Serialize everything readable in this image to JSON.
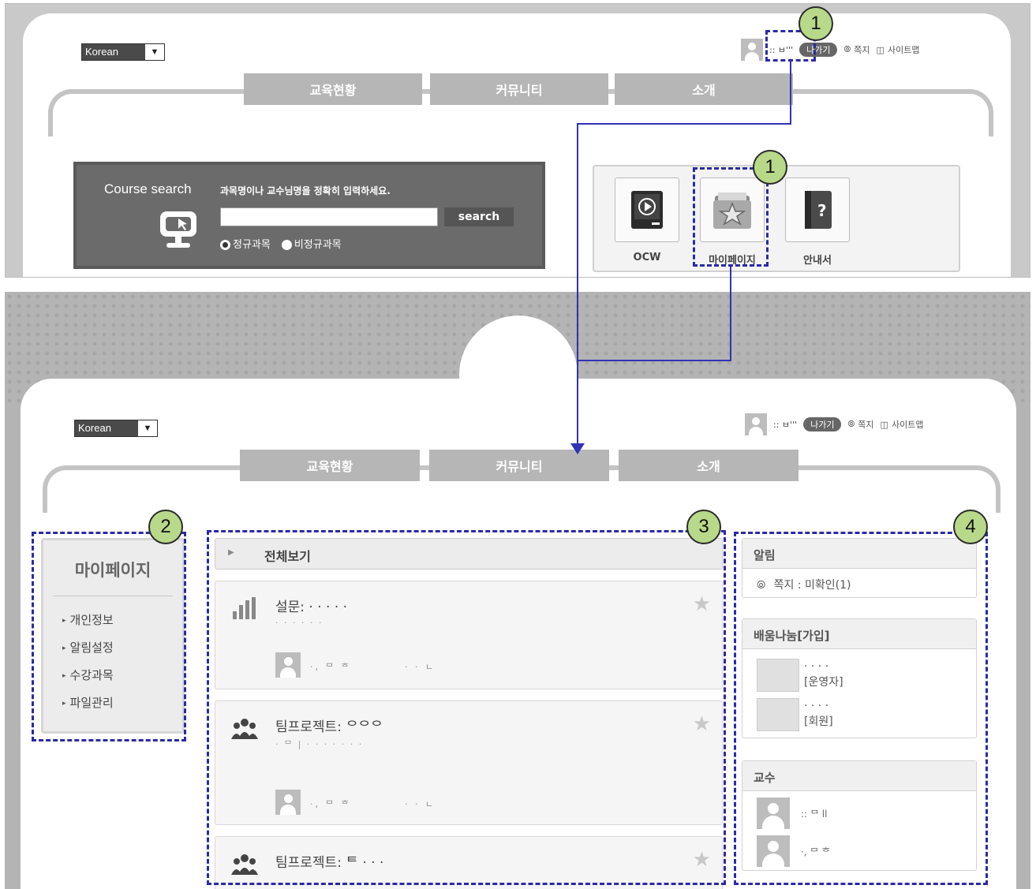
{
  "top": {
    "language_select": "Korean",
    "user_name": ":: ㅂ'''",
    "logout_label": "나가기",
    "note_label": "쪽지",
    "sitemap_label": "사이트맵",
    "nav_tabs": [
      "교육현황",
      "커뮤니티",
      "소개"
    ],
    "search": {
      "title": "Course search",
      "hint": "과목명이나 교수님명을 정확히 입력하세요.",
      "input_value": "",
      "button_label": "search",
      "radio_options": [
        "정규과목",
        "비정규과목"
      ],
      "selected_radio": "정규과목"
    },
    "quick_links": [
      "OCW",
      "마이페이지",
      "안내서"
    ]
  },
  "bottom": {
    "language_select": "Korean",
    "user_name": ":: ㅂ'''",
    "logout_label": "나가기",
    "note_label": "쪽지",
    "sitemap_label": "사이트맵",
    "nav_tabs": [
      "교육현황",
      "커뮤니티",
      "소개"
    ],
    "sidebar": {
      "title": "마이페이지",
      "items": [
        "개인정보",
        "알림설정",
        "수강과목",
        "파일관리"
      ]
    },
    "feed": {
      "view_all_label": "전체보기",
      "items": [
        {
          "title": "설문: · · · · ·",
          "sub": "· · · · · ·",
          "author": "·, ᄆ ᄒ",
          "meta": "· · ㄴ"
        },
        {
          "title": "팀프로젝트: ᄋᄋᄋ",
          "sub": "· ᄆ | · · · · · · ·",
          "author": "·, ᄆ ᄒ",
          "meta": "· · ㄴ"
        },
        {
          "title": "팀프로젝트: ᄐ · · ·",
          "sub": "",
          "author": "",
          "meta": ""
        }
      ]
    },
    "notice": {
      "title": "알림",
      "note_status": "쪽지 : 미확인(1)"
    },
    "learning_share": {
      "title": "배움나눔[가입]",
      "items": [
        {
          "name": "· · · ·",
          "role": "[운영자]"
        },
        {
          "name": "· · · ·",
          "role": "[회원]"
        }
      ]
    },
    "professors": {
      "title": "교수",
      "items": [
        ":: ᄆ ll",
        "·, ᄆ ᄒ"
      ]
    }
  },
  "annotations": {
    "badges": [
      "1",
      "1",
      "2",
      "3",
      "4"
    ]
  }
}
